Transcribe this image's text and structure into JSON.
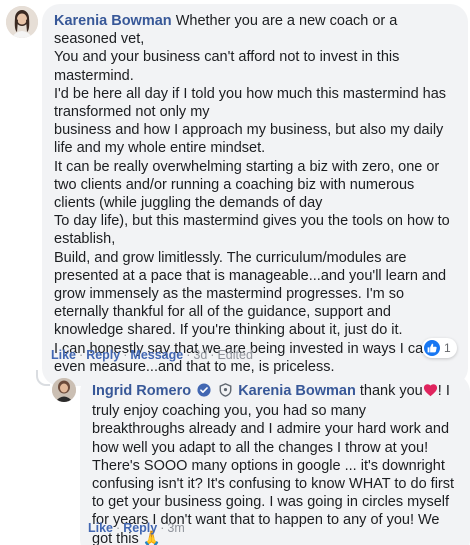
{
  "comment": {
    "author": "Karenia Bowman",
    "lines": [
      "Whether you are a new coach or a seasoned vet,",
      "You and your business can't afford not to invest in this mastermind.",
      "I'd be here all day if I told you how much this mastermind has transformed not only my",
      "business and how I approach my business, but also my daily life and my whole entire mindset.",
      "It can be really overwhelming starting a biz with zero, one or two clients and/or running a coaching biz with numerous clients (while juggling the demands of day",
      "To day life), but this mastermind gives you the tools on how to establish,",
      "Build, and grow limitlessly. The curriculum/modules are presented at a pace that is manageable...and you'll learn and grow immensely as the mastermind progresses. I'm so eternally thankful for all of the guidance, support and knowledge shared. If you're thinking about it, just do it.",
      "I can honestly say that we are being invested in ways I can't even measure...and that to me, is priceless."
    ],
    "actions": {
      "like": "Like",
      "reply": "Reply",
      "message": "Message",
      "time": "3d",
      "edited": "Edited"
    },
    "reaction_count": "1"
  },
  "reply": {
    "author": "Ingrid Romero",
    "mention": "Karenia Bowman",
    "text_before_heart": " thank you",
    "text_after_heart": "! I truly enjoy coaching you, you had so many breakthroughs already and I admire your hard work and how well you adapt to all the changes I throw at you! There's SOOO many options in google ... it's downright confusing isn't it? It's confusing to know WHAT to do first to get your business going. I was going in circles myself for years I don't want that to happen to any of you! We got this ",
    "emoji": "🙏",
    "actions": {
      "like": "Like",
      "reply": "Reply",
      "time": "3m"
    }
  },
  "colors": {
    "author": "#385898",
    "link": "#4267b2",
    "bubble": "#f2f3f5",
    "heart": "#e0245e",
    "like_blue": "#1877f2"
  }
}
